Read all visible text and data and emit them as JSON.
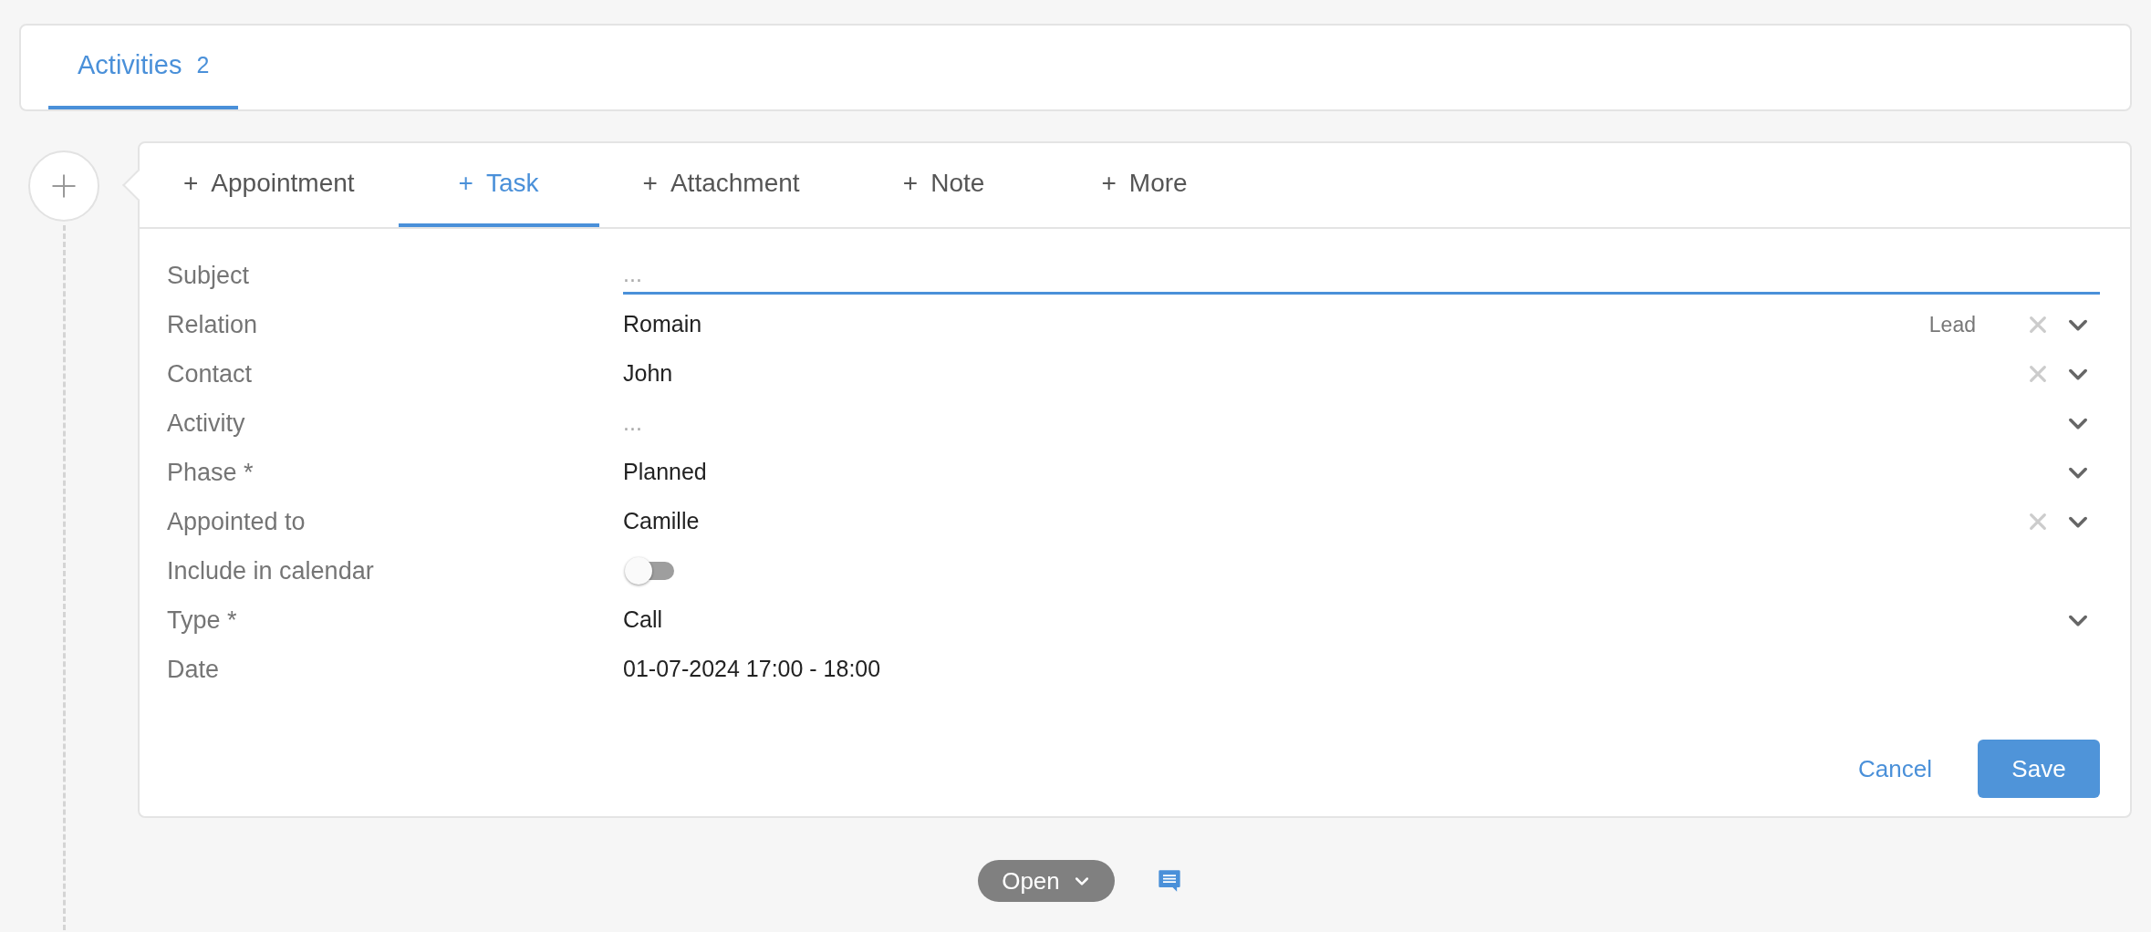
{
  "top_tabs": [
    {
      "label": "Activities",
      "count": "2",
      "selected": true
    }
  ],
  "composer": {
    "tabs": [
      {
        "icon": "+",
        "label": "Appointment",
        "selected": false
      },
      {
        "icon": "+",
        "label": "Task",
        "selected": true
      },
      {
        "icon": "+",
        "label": "Attachment",
        "selected": false
      },
      {
        "icon": "+",
        "label": "Note",
        "selected": false
      },
      {
        "icon": "+",
        "label": "More",
        "selected": false
      }
    ],
    "fields": [
      {
        "label": "Subject",
        "kind": "input",
        "placeholder": "..."
      },
      {
        "label": "Relation",
        "kind": "select",
        "value": "Romain",
        "tag": "Lead",
        "clearable": true
      },
      {
        "label": "Contact",
        "kind": "select",
        "value": "John",
        "clearable": true
      },
      {
        "label": "Activity",
        "kind": "select",
        "placeholder": "...",
        "clearable": false
      },
      {
        "label": "Phase *",
        "kind": "select",
        "value": "Planned",
        "clearable": false
      },
      {
        "label": "Appointed to",
        "kind": "select",
        "value": "Camille",
        "clearable": true
      },
      {
        "label": "Include in calendar",
        "kind": "toggle",
        "on": false
      },
      {
        "label": "Type *",
        "kind": "select",
        "value": "Call",
        "clearable": false
      },
      {
        "label": "Date",
        "kind": "value",
        "value": "01-07-2024 17:00 - 18:00"
      }
    ],
    "actions": {
      "cancel": "Cancel",
      "save": "Save"
    }
  },
  "status": {
    "label": "Open"
  }
}
